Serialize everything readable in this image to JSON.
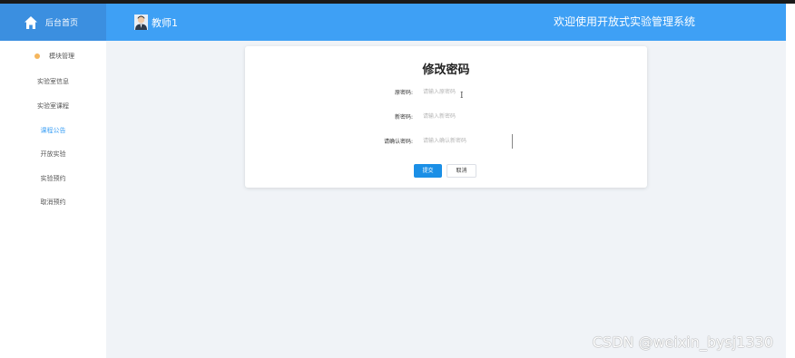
{
  "header": {
    "home_label": "后台首页",
    "user_name": "教师1",
    "welcome": "欢迎使用开放式实验管理系统"
  },
  "sidebar": {
    "section_label": "模块管理",
    "items": [
      {
        "label": "实验室信息"
      },
      {
        "label": "实验室课程"
      },
      {
        "label": "课程公告",
        "active": true
      },
      {
        "label": "开放实验"
      },
      {
        "label": "实验预约"
      },
      {
        "label": "取消预约"
      }
    ]
  },
  "form": {
    "title": "修改密码",
    "old_password": {
      "label": "原密码:",
      "placeholder": "请输入原密码"
    },
    "new_password": {
      "label": "新密码:",
      "placeholder": "请输入新密码"
    },
    "confirm_password": {
      "label": "请确认密码:",
      "placeholder": "请输入确认新密码"
    },
    "submit_label": "提交",
    "cancel_label": "取消"
  },
  "watermark": "CSDN @weixin_bysj1330",
  "colors": {
    "header": "#3ea0f5",
    "brand": "#3b8fe0",
    "primary_button": "#1b8fe6",
    "active_menu": "#3ea0f5",
    "section_dot": "#f5b65d"
  },
  "icons": {
    "home": "home-icon",
    "avatar": "avatar-icon",
    "section": "dot-icon"
  }
}
